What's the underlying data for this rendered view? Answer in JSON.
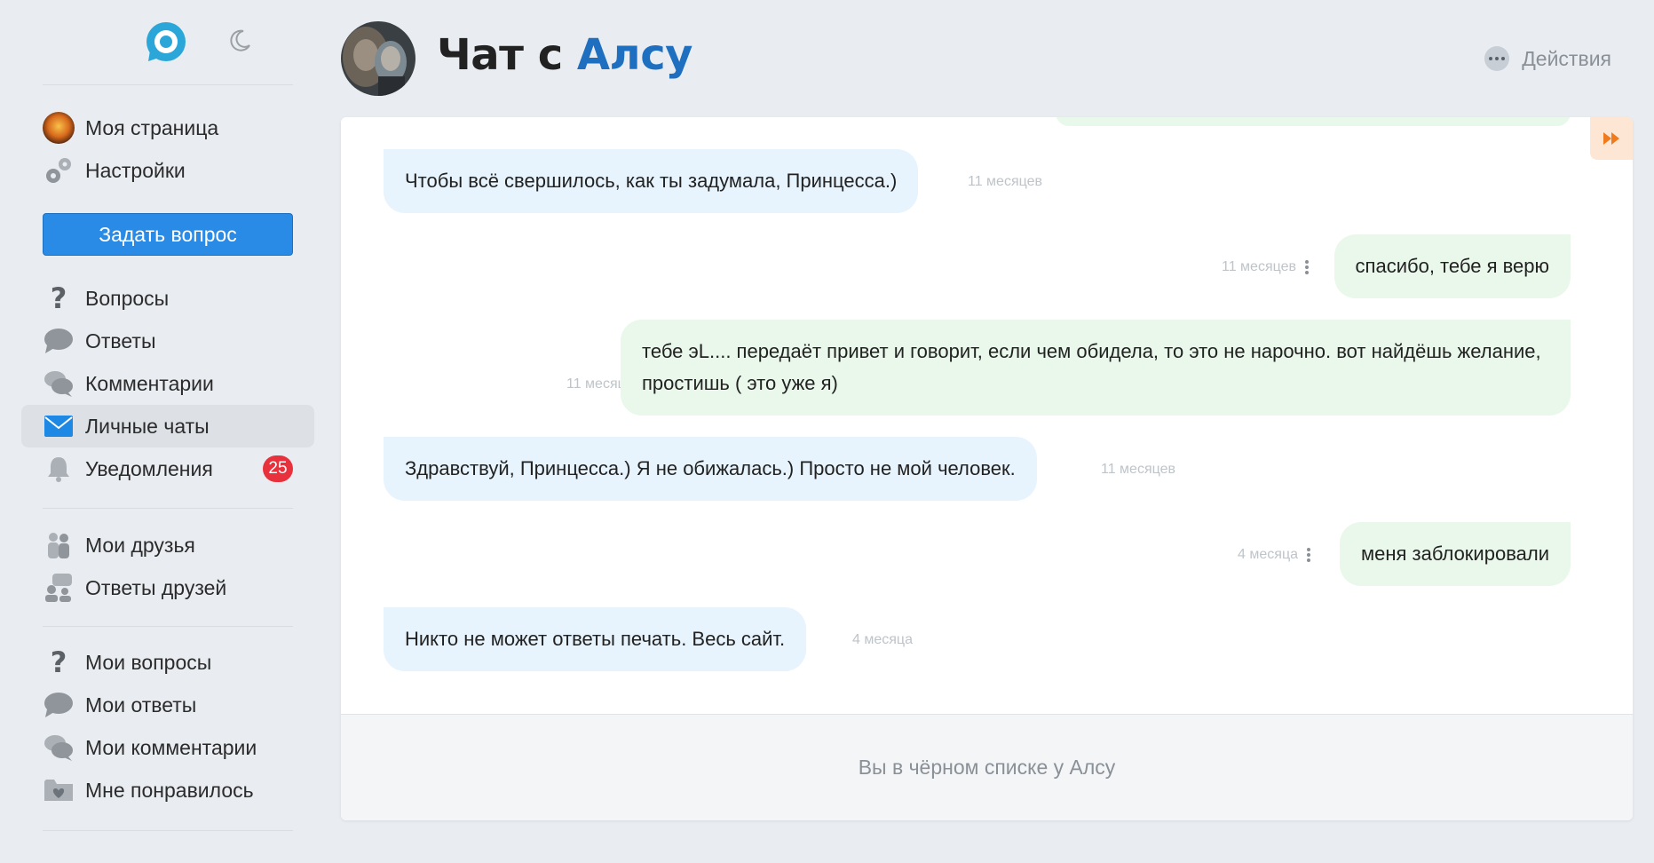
{
  "sidebar": {
    "logo_icon": "logo-ring-icon",
    "theme_icon": "moon-icon",
    "items_top": [
      {
        "label": "Моя страница",
        "icon": "avatar-icon"
      },
      {
        "label": "Настройки",
        "icon": "gears-icon"
      }
    ],
    "ask_button": "Задать вопрос",
    "items_main": [
      {
        "label": "Вопросы",
        "icon": "question-icon"
      },
      {
        "label": "Ответы",
        "icon": "speech-bubble-icon"
      },
      {
        "label": "Комментарии",
        "icon": "comments-icon"
      },
      {
        "label": "Личные чаты",
        "icon": "envelope-icon",
        "active": true
      },
      {
        "label": "Уведомления",
        "icon": "bell-icon",
        "badge": "25"
      }
    ],
    "items_friends": [
      {
        "label": "Мои друзья",
        "icon": "friends-icon"
      },
      {
        "label": "Ответы друзей",
        "icon": "friends-answers-icon"
      }
    ],
    "items_mine": [
      {
        "label": "Мои вопросы",
        "icon": "question-icon"
      },
      {
        "label": "Мои ответы",
        "icon": "speech-bubble-icon"
      },
      {
        "label": "Мои комментарии",
        "icon": "comments-icon"
      },
      {
        "label": "Мне понравилось",
        "icon": "heart-folder-icon"
      }
    ],
    "badge_color": "#e8313c",
    "accent_color": "#2a8be6"
  },
  "header": {
    "title_prefix": "Чат с",
    "title_name": "Алсу",
    "actions_label": "Действия",
    "name_color": "#1f6fc0"
  },
  "messages": [
    {
      "dir": "in",
      "text": "Чтобы всё свершилось, как ты задумала, Принцесса.)",
      "time": "11 месяцев"
    },
    {
      "dir": "out",
      "text": "спасибо, тебе я верю",
      "time": "11 месяцев"
    },
    {
      "dir": "out",
      "text": "тебе эL.... передаёт привет и говорит, если чем обидела, то это не нарочно. вот найдёшь желание, простишь ( это уже я)",
      "time": "11 месяцев"
    },
    {
      "dir": "in",
      "text": "Здравствуй, Принцесса.) Я не обижалась.) Просто не мой человек.",
      "time": "11 месяцев"
    },
    {
      "dir": "out",
      "text": "меня заблокировали",
      "time": "4 месяца"
    },
    {
      "dir": "in",
      "text": "Никто не может ответы печать. Весь сайт.",
      "time": "4 месяца"
    }
  ],
  "footer": {
    "text": "Вы в чёрном списке у Алсу"
  },
  "colors": {
    "incoming_bubble": "#e7f4fd",
    "outgoing_bubble": "#e9f8eb",
    "page_bg": "#e9edf1"
  }
}
